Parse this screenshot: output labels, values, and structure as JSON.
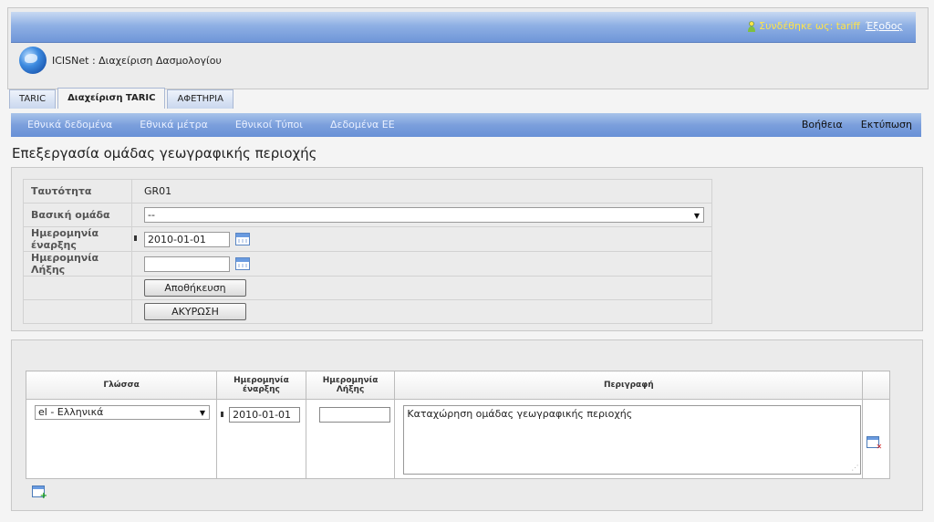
{
  "header": {
    "login_label": "Συνδέθηκε ως: tariff",
    "logout_label": "Έξοδος",
    "app_title": "ICISNet : Διαχείριση Δασμολογίου"
  },
  "tabs": [
    {
      "label": "TARIC",
      "active": false
    },
    {
      "label": "Διαχείριση TARIC",
      "active": true
    },
    {
      "label": "ΑΦΕΤΗΡΙΑ",
      "active": false
    }
  ],
  "nav": {
    "left": [
      "Εθνικά δεδομένα",
      "Εθνικά μέτρα",
      "Εθνικοί Τύποι",
      "Δεδομένα ΕΕ"
    ],
    "right": [
      "Βοήθεια",
      "Εκτύπωση"
    ]
  },
  "page_title": "Επεξεργασία ομάδας γεωγραφικής περιοχής",
  "form": {
    "id_label": "Ταυτότητα",
    "id_value": "GR01",
    "base_group_label": "Βασική ομάδα",
    "base_group_value": "--",
    "start_date_label": "Ημερομηνία έναρξης",
    "start_date_value": "2010-01-01",
    "end_date_label": "Ημερομηνία Λήξης",
    "end_date_value": "",
    "save_label": "Αποθήκευση",
    "cancel_label": "ΑΚΥΡΩΣΗ"
  },
  "lang_table": {
    "headers": [
      "Γλώσσα",
      "Ημερομηνία έναρξης",
      "Ημερομηνία Λήξης",
      "Περιγραφή"
    ],
    "rows": [
      {
        "language": "el - Ελληνικά",
        "start_date": "2010-01-01",
        "end_date": "",
        "description": "Καταχώρηση ομάδας γεωγραφικής περιοχής"
      }
    ]
  },
  "colors": {
    "accent_blue": "#7b9fdc",
    "login_text": "#ffe44a"
  },
  "icons": {
    "user": "user-icon",
    "globe": "globe-logo",
    "calendar": "calendar-icon",
    "delete_row": "delete-row-icon",
    "add_row": "add-row-icon"
  }
}
